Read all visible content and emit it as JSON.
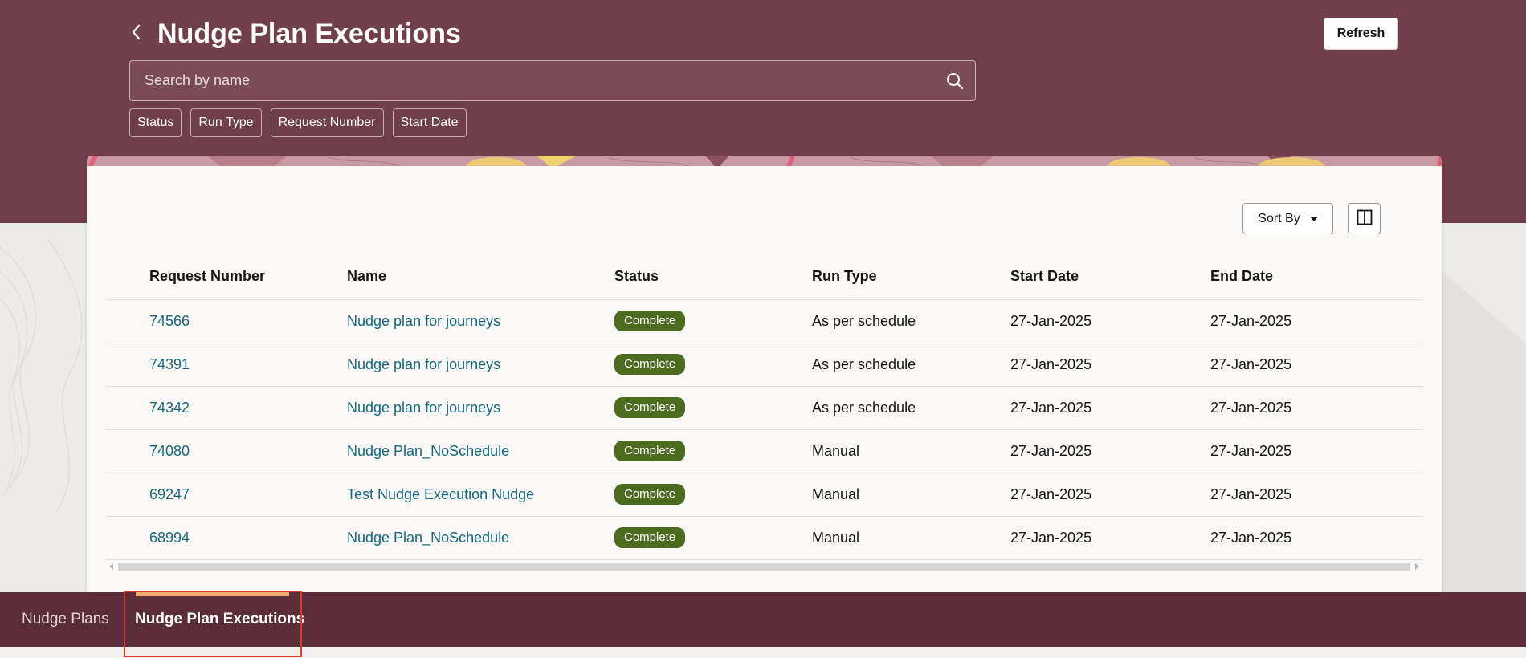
{
  "header": {
    "title": "Nudge Plan Executions",
    "refresh_label": "Refresh"
  },
  "search": {
    "placeholder": "Search by name"
  },
  "filters": [
    "Status",
    "Run Type",
    "Request Number",
    "Start Date"
  ],
  "toolbar": {
    "sort_label": "Sort By"
  },
  "table": {
    "columns": [
      "Request Number",
      "Name",
      "Status",
      "Run Type",
      "Start Date",
      "End Date"
    ],
    "rows": [
      {
        "request": "74566",
        "name": "Nudge plan for journeys",
        "status": "Complete",
        "run_type": "As per schedule",
        "start": "27-Jan-2025",
        "end": "27-Jan-2025"
      },
      {
        "request": "74391",
        "name": "Nudge plan for journeys",
        "status": "Complete",
        "run_type": "As per schedule",
        "start": "27-Jan-2025",
        "end": "27-Jan-2025"
      },
      {
        "request": "74342",
        "name": "Nudge plan for journeys",
        "status": "Complete",
        "run_type": "As per schedule",
        "start": "27-Jan-2025",
        "end": "27-Jan-2025"
      },
      {
        "request": "74080",
        "name": "Nudge Plan_NoSchedule",
        "status": "Complete",
        "run_type": "Manual",
        "start": "27-Jan-2025",
        "end": "27-Jan-2025"
      },
      {
        "request": "69247",
        "name": "Test Nudge Execution Nudge",
        "status": "Complete",
        "run_type": "Manual",
        "start": "27-Jan-2025",
        "end": "27-Jan-2025"
      },
      {
        "request": "68994",
        "name": "Nudge Plan_NoSchedule",
        "status": "Complete",
        "run_type": "Manual",
        "start": "27-Jan-2025",
        "end": "27-Jan-2025"
      }
    ]
  },
  "bottom_nav": {
    "items": [
      "Nudge Plans",
      "Nudge Plan Executions"
    ],
    "active": "Nudge Plan Executions"
  },
  "colors": {
    "header_bg": "#703f4b",
    "nav_bg": "#5b2d38",
    "status_complete": "#4c6b1f",
    "link": "#15677f",
    "active_indicator": "#eab26c",
    "highlight_box": "#e0392b"
  },
  "icons": {
    "back": "chevron-left-icon",
    "search": "search-icon",
    "sort_caret": "caret-down-icon",
    "panel": "split-panel-icon"
  }
}
